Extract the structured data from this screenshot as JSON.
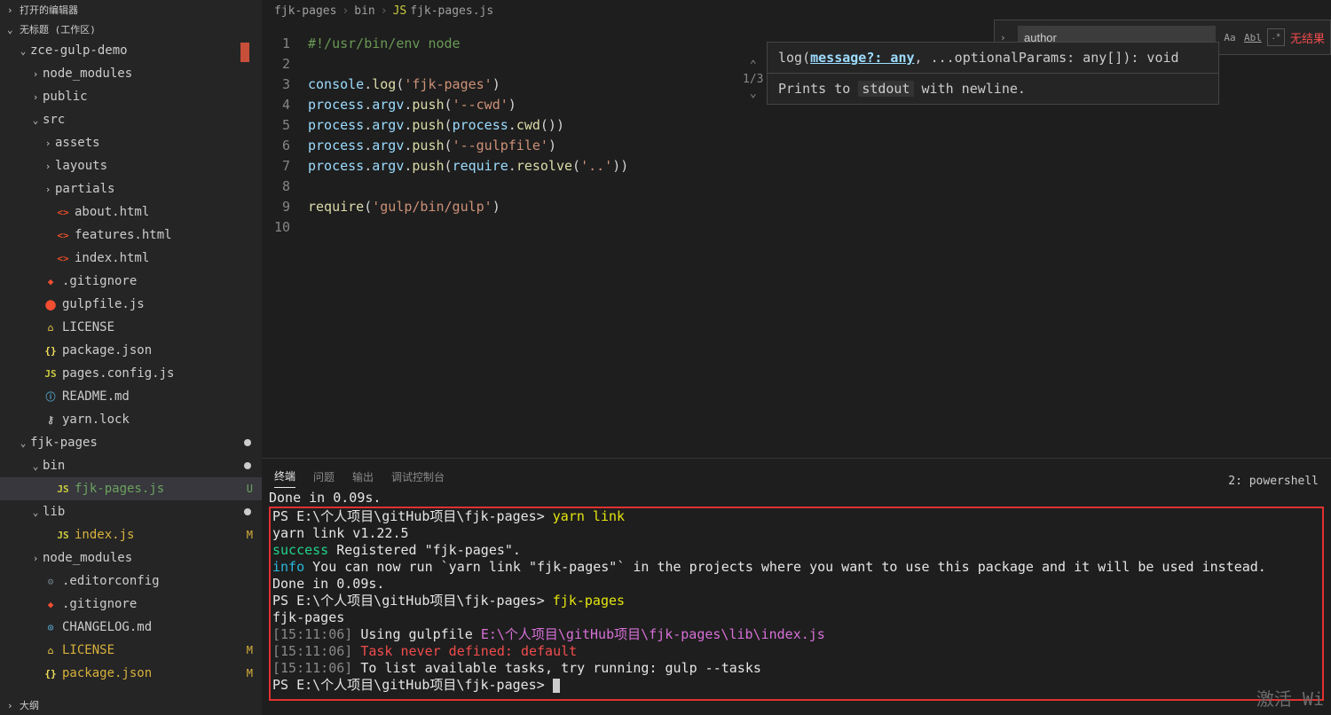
{
  "sidebar": {
    "header_open": "打开的编辑器",
    "workspace": "无标题 (工作区)",
    "outline": "大纲"
  },
  "tree": [
    {
      "d": 1,
      "tw": "v",
      "ic": "",
      "cls": "",
      "lbl": "zce-gulp-demo",
      "deco": "marker"
    },
    {
      "d": 2,
      "tw": ">",
      "ic": "",
      "cls": "",
      "lbl": "node_modules"
    },
    {
      "d": 2,
      "tw": ">",
      "ic": "",
      "cls": "",
      "lbl": "public"
    },
    {
      "d": 2,
      "tw": "v",
      "ic": "",
      "cls": "",
      "lbl": "src"
    },
    {
      "d": 3,
      "tw": ">",
      "ic": "",
      "cls": "",
      "lbl": "assets"
    },
    {
      "d": 3,
      "tw": ">",
      "ic": "",
      "cls": "",
      "lbl": "layouts"
    },
    {
      "d": 3,
      "tw": ">",
      "ic": "",
      "cls": "",
      "lbl": "partials"
    },
    {
      "d": 3,
      "tw": "",
      "ic": "<>",
      "cls": "i-html",
      "lbl": "about.html"
    },
    {
      "d": 3,
      "tw": "",
      "ic": "<>",
      "cls": "i-html",
      "lbl": "features.html"
    },
    {
      "d": 3,
      "tw": "",
      "ic": "<>",
      "cls": "i-html",
      "lbl": "index.html"
    },
    {
      "d": 2,
      "tw": "",
      "ic": "◆",
      "cls": "i-git",
      "lbl": ".gitignore"
    },
    {
      "d": 2,
      "tw": "",
      "ic": "⬤",
      "cls": "i-git",
      "lbl": "gulpfile.js"
    },
    {
      "d": 2,
      "tw": "",
      "ic": "⌂",
      "cls": "i-lic",
      "lbl": "LICENSE"
    },
    {
      "d": 2,
      "tw": "",
      "ic": "{}",
      "cls": "i-json",
      "lbl": "package.json"
    },
    {
      "d": 2,
      "tw": "",
      "ic": "JS",
      "cls": "i-js",
      "lbl": "pages.config.js"
    },
    {
      "d": 2,
      "tw": "",
      "ic": "ⓘ",
      "cls": "i-md",
      "lbl": "README.md"
    },
    {
      "d": 2,
      "tw": "",
      "ic": "⚷",
      "cls": "i-lock",
      "lbl": "yarn.lock"
    },
    {
      "d": 1,
      "tw": "v",
      "ic": "",
      "cls": "",
      "lbl": "fjk-pages",
      "deco": "dot"
    },
    {
      "d": 2,
      "tw": "v",
      "ic": "",
      "cls": "",
      "lbl": "bin",
      "deco": "dot"
    },
    {
      "d": 3,
      "tw": "",
      "ic": "JS",
      "cls": "i-js",
      "lbl": "fjk-pages.js",
      "sel": true,
      "deco": "U"
    },
    {
      "d": 2,
      "tw": "v",
      "ic": "",
      "cls": "",
      "lbl": "lib",
      "deco": "dot"
    },
    {
      "d": 3,
      "tw": "",
      "ic": "JS",
      "cls": "i-js",
      "lbl": "index.js",
      "deco": "M"
    },
    {
      "d": 2,
      "tw": ">",
      "ic": "",
      "cls": "",
      "lbl": "node_modules"
    },
    {
      "d": 2,
      "tw": "",
      "ic": "⚙",
      "cls": "i-cfg",
      "lbl": ".editorconfig"
    },
    {
      "d": 2,
      "tw": "",
      "ic": "◆",
      "cls": "i-git",
      "lbl": ".gitignore"
    },
    {
      "d": 2,
      "tw": "",
      "ic": "⊙",
      "cls": "i-md",
      "lbl": "CHANGELOG.md"
    },
    {
      "d": 2,
      "tw": "",
      "ic": "⌂",
      "cls": "i-lic",
      "lbl": "LICENSE",
      "deco": "M"
    },
    {
      "d": 2,
      "tw": "",
      "ic": "{}",
      "cls": "i-json",
      "lbl": "package.json",
      "deco": "M"
    }
  ],
  "breadcrumbs": [
    "fjk-pages",
    "bin",
    "fjk-pages.js"
  ],
  "breadcrumb_icon": "JS",
  "code_lines": [
    [
      [
        "com",
        "#!/usr/bin/env node"
      ]
    ],
    [],
    [
      [
        "obj",
        "console"
      ],
      [
        "pn",
        "."
      ],
      [
        "fn",
        "log"
      ],
      [
        "pn",
        "("
      ],
      [
        "str",
        "'fjk-pages'"
      ],
      [
        "pn",
        ")"
      ]
    ],
    [
      [
        "obj",
        "process"
      ],
      [
        "pn",
        "."
      ],
      [
        "obj",
        "argv"
      ],
      [
        "pn",
        "."
      ],
      [
        "fn",
        "push"
      ],
      [
        "pn",
        "("
      ],
      [
        "str",
        "'--cwd'"
      ],
      [
        "pn",
        ")"
      ]
    ],
    [
      [
        "obj",
        "process"
      ],
      [
        "pn",
        "."
      ],
      [
        "obj",
        "argv"
      ],
      [
        "pn",
        "."
      ],
      [
        "fn",
        "push"
      ],
      [
        "pn",
        "("
      ],
      [
        "obj",
        "process"
      ],
      [
        "pn",
        "."
      ],
      [
        "fn",
        "cwd"
      ],
      [
        "pn",
        "())"
      ]
    ],
    [
      [
        "obj",
        "process"
      ],
      [
        "pn",
        "."
      ],
      [
        "obj",
        "argv"
      ],
      [
        "pn",
        "."
      ],
      [
        "fn",
        "push"
      ],
      [
        "pn",
        "("
      ],
      [
        "str",
        "'--gulpfile'"
      ],
      [
        "pn",
        ")"
      ]
    ],
    [
      [
        "obj",
        "process"
      ],
      [
        "pn",
        "."
      ],
      [
        "obj",
        "argv"
      ],
      [
        "pn",
        "."
      ],
      [
        "fn",
        "push"
      ],
      [
        "pn",
        "("
      ],
      [
        "obj",
        "require"
      ],
      [
        "pn",
        "."
      ],
      [
        "fn",
        "resolve"
      ],
      [
        "pn",
        "("
      ],
      [
        "str",
        "'..'"
      ],
      [
        "pn",
        "))"
      ]
    ],
    [],
    [
      [
        "fn",
        "require"
      ],
      [
        "pn",
        "("
      ],
      [
        "str",
        "'gulp/bin/gulp'"
      ],
      [
        "pn",
        ")"
      ]
    ],
    []
  ],
  "tooltip": {
    "counter": "1/3",
    "prefix": "log(",
    "param": "message?: any",
    "rest": ", ...optionalParams: any[]): void",
    "desc_pre": "Prints to ",
    "desc_code": "stdout",
    "desc_post": " with newline."
  },
  "find": {
    "value": "author",
    "nores": "无结果",
    "case": "Aa",
    "word": "Abl",
    "regex": ".*"
  },
  "panel": {
    "tabs": [
      "终端",
      "问题",
      "输出",
      "调试控制台"
    ],
    "right": "2: powershell"
  },
  "terminal": [
    [
      [
        "wh",
        "Done in 0.09s."
      ]
    ],
    [
      [
        "wh",
        "PS E:\\个人项目\\gitHub项目\\fjk-pages> "
      ],
      [
        "ye",
        "yarn link"
      ]
    ],
    [
      [
        "wh",
        "yarn link v1.22.5"
      ]
    ],
    [
      [
        "gr",
        "success"
      ],
      [
        "wh",
        " Registered \"fjk-pages\"."
      ]
    ],
    [
      [
        "cy",
        "info"
      ],
      [
        "wh",
        " You can now run `yarn link \"fjk-pages\"` in the projects where you want to use this package and it will be used instead."
      ]
    ],
    [
      [
        "wh",
        "Done in 0.09s."
      ]
    ],
    [
      [
        "wh",
        "PS E:\\个人项目\\gitHub项目\\fjk-pages> "
      ],
      [
        "ye",
        "fjk-pages"
      ]
    ],
    [
      [
        "wh",
        "fjk-pages"
      ]
    ],
    [
      [
        "gy",
        "[15:11:06]"
      ],
      [
        "wh",
        " Using gulpfile "
      ],
      [
        "mg",
        "E:\\个人项目\\gitHub项目\\fjk-pages\\lib\\index.js"
      ]
    ],
    [
      [
        "gy",
        "[15:11:06]"
      ],
      [
        "rd",
        " Task never defined: default"
      ]
    ],
    [
      [
        "gy",
        "[15:11:06]"
      ],
      [
        "wh",
        " To list available tasks, try running: gulp --tasks"
      ]
    ],
    [
      [
        "wh",
        "PS E:\\个人项目\\gitHub项目\\fjk-pages> "
      ]
    ]
  ],
  "activate": "激活 Wi"
}
